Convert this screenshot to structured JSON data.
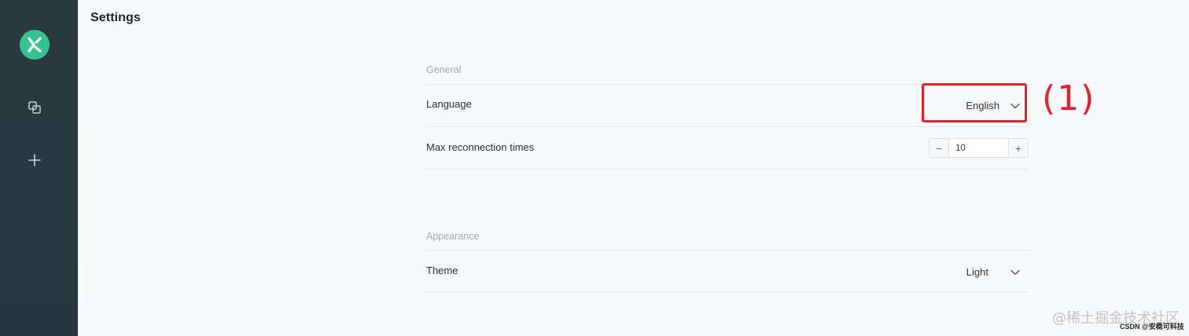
{
  "page": {
    "title": "Settings"
  },
  "sidebar": {
    "logo_icon": "app-logo-icon",
    "items": [
      {
        "icon": "connections-icon"
      },
      {
        "icon": "plus-icon"
      }
    ]
  },
  "sections": {
    "general": {
      "title": "General",
      "language": {
        "label": "Language",
        "value": "English"
      },
      "max_reconnection": {
        "label": "Max reconnection times",
        "value": "10",
        "decrement": "−",
        "increment": "+"
      }
    },
    "appearance": {
      "title": "Appearance",
      "theme": {
        "label": "Theme",
        "value": "Light"
      }
    }
  },
  "annotation": {
    "label": "(1)",
    "color": "#e8202a"
  },
  "watermarks": {
    "primary": "@稀土掘金技术社区",
    "secondary": "CSDN @安稳可科技"
  },
  "colors": {
    "sidebar": "#2b3a40",
    "accent": "#34c38f",
    "highlight": "#e8202a"
  }
}
